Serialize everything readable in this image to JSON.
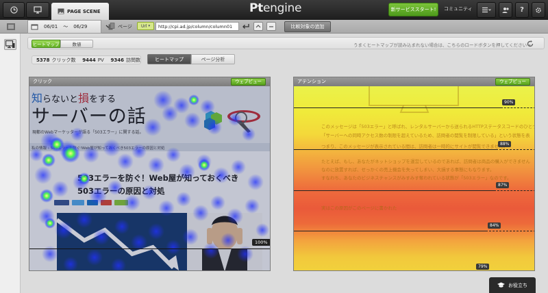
{
  "topbar": {
    "tab_label": "PAGE SCENE",
    "logo_pt": "Pt",
    "logo_engine": "engine",
    "new_service_button": "新サービススタート!",
    "community": "コミュニティ"
  },
  "filter": {
    "date_start": "06/01",
    "date_sep": "～",
    "date_end": "06/29",
    "page_label": "ページ",
    "url_badge": "Url",
    "url_value": "http://cpi.ad.jp/column/column01",
    "compare_button": "比較対象の追加"
  },
  "mode": {
    "heatmap": "ヒートマップ",
    "numbers": "数値",
    "hint": "うまくヒートマップが読み込まれない場合は、こちらのロードボタンを押してください→"
  },
  "stats": {
    "clicks_value": "5378",
    "clicks_label": "クリック数",
    "pv_value": "9444",
    "pv_label": "PV",
    "visits_value": "9346",
    "visits_label": "訪問数"
  },
  "view_tabs": {
    "heatmap": "ヒートマップ",
    "page_analysis": "ページ分析"
  },
  "click_panel": {
    "title": "クリック",
    "webview": "ウェブビュー",
    "site_title_a": "知",
    "site_title_b": "らないと",
    "site_title_c": "損",
    "site_title_d": "をする",
    "site_big": "サーバーの話",
    "site_desc": "現都のWebマーケッターが語る「503エラー」に関する話。",
    "breadcrumb": "私の情報 › 503エラーを防ぐ!Web屋が知っておくべき503エラーの原因と対処",
    "article_title_1": "503エラーを防ぐ！Web屋が知っておくべき",
    "article_title_2": "503エラーの原因と対処",
    "pct": "100%"
  },
  "attention_panel": {
    "title": "アテンション",
    "webview": "ウェブビュー",
    "badges": [
      "90%",
      "88%",
      "87%",
      "84%",
      "79%"
    ],
    "texts": [
      "このメッセージは「503エラー」と呼ばれ、レンタルサーバーから送られるHTTPステータスコードのひとつ",
      "「サーバーへの同時アクセス数の制限を超えているため、訪問者の閲覧を制限している」という状態を表",
      "つまり、このメッセージが表示されている間は、訪問者は一時的にサイトが閲覧できません。",
      "たとえば、もし、あなたがネットショップを運営しているのであれば、訪問者は商品の購入ができません",
      "なのに放置すれば、せっかくの売上機会を失ってしまい、大損する事態にもなります。",
      "すなわち、あなたのビジネスチャンスがみすみす奪われている状態が「503エラー」なのです。",
      "実はこの原因がこのページに書かれた"
    ]
  },
  "help_button": "お役立ち"
}
